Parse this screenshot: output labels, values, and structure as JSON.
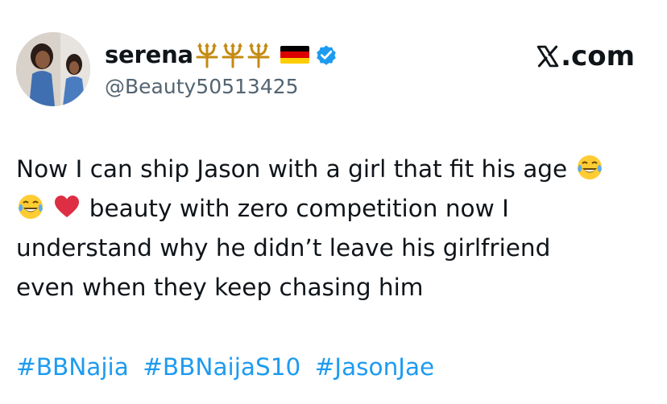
{
  "author": {
    "display_name": "serena",
    "handle": "@Beauty50513425",
    "name_emojis": [
      "trident-emblem",
      "trident-emblem",
      "trident-emblem",
      "germany-flag"
    ],
    "verified": true
  },
  "brand": {
    "label": ".com"
  },
  "tweet": {
    "line1_text": "Now I can ship Jason with a girl that fit his age",
    "line2_text": "beauty with zero competition now I",
    "line3_text": "understand why he didn’t leave his girlfriend",
    "line4_text": "even when they keep chasing him",
    "emojis": [
      "face-with-tears-of-joy",
      "face-with-tears-of-joy",
      "red-heart"
    ]
  },
  "hashtags": [
    "#BBNajia",
    "#BBNaijaS10",
    "#JasonJae"
  ],
  "colors": {
    "text": "#0f1419",
    "secondary_text": "#536471",
    "link": "#1d9bf0",
    "verified": "#1d9bf0"
  }
}
